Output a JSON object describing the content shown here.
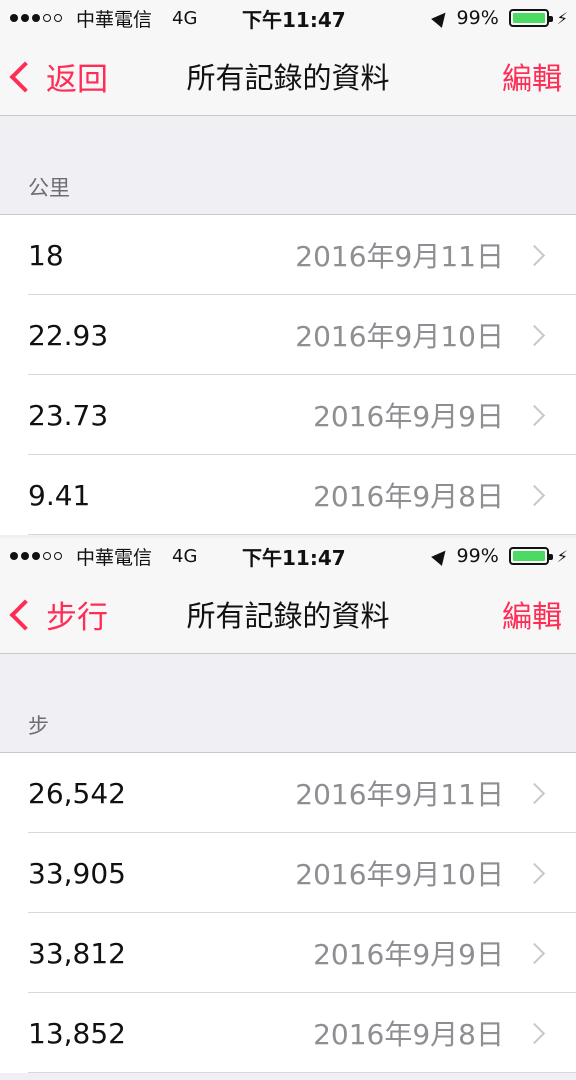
{
  "screens": [
    {
      "status": {
        "carrier": "中華電信",
        "network": "4G",
        "time": "下午11:47",
        "battery": "99%",
        "charging_icon": "⚡"
      },
      "nav": {
        "back_label": "返回",
        "title": "所有記錄的資料",
        "edit_label": "編輯"
      },
      "section_header": "公里",
      "rows": [
        {
          "value": "18",
          "date": "2016年9月11日"
        },
        {
          "value": "22.93",
          "date": "2016年9月10日"
        },
        {
          "value": "23.73",
          "date": "2016年9月9日"
        },
        {
          "value": "9.41",
          "date": "2016年9月8日"
        }
      ]
    },
    {
      "status": {
        "carrier": "中華電信",
        "network": "4G",
        "time": "下午11:47",
        "battery": "99%",
        "charging_icon": "⚡"
      },
      "nav": {
        "back_label": "步行",
        "title": "所有記錄的資料",
        "edit_label": "編輯"
      },
      "section_header": "步",
      "rows": [
        {
          "value": "26,542",
          "date": "2016年9月11日"
        },
        {
          "value": "33,905",
          "date": "2016年9月10日"
        },
        {
          "value": "33,812",
          "date": "2016年9月9日"
        },
        {
          "value": "13,852",
          "date": "2016年9月8日"
        }
      ]
    }
  ],
  "colors": {
    "accent": "#ff2d55",
    "battery": "#4cd964",
    "section_bg": "#efeff4"
  },
  "icons": {
    "signal": "signal-dots-icon",
    "location": "location-arrow-icon",
    "battery": "battery-icon",
    "back": "chevron-left-icon",
    "row_disclosure": "chevron-right-icon"
  }
}
